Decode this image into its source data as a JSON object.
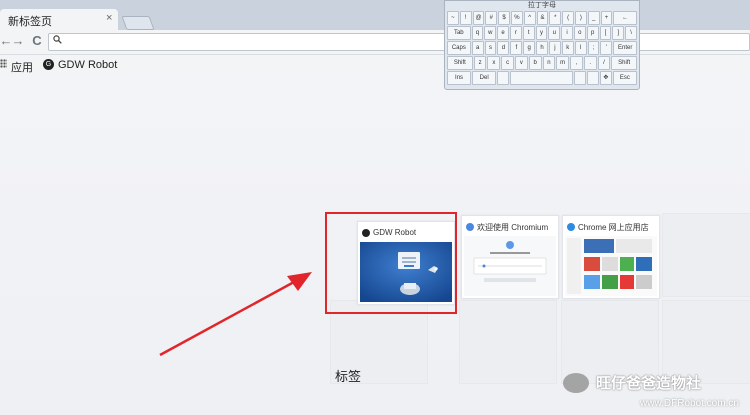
{
  "tab": {
    "title": "新标签页",
    "close": "×"
  },
  "toolbar": {
    "back": "←",
    "forward": "→",
    "reload": "C",
    "search_icon": "search-icon",
    "url": ""
  },
  "bookmarks": {
    "apps_label": "应用",
    "items": [
      {
        "label": "GDW Robot"
      }
    ]
  },
  "keyboard": {
    "title": "拉丁字母",
    "rows": [
      [
        "~",
        "!",
        "@",
        "#",
        "$",
        "%",
        "^",
        "&",
        "*",
        "(",
        ")",
        "_",
        "+",
        "←"
      ],
      [
        "Tab",
        "q",
        "w",
        "e",
        "r",
        "t",
        "y",
        "u",
        "i",
        "o",
        "p",
        "[",
        "]",
        "\\"
      ],
      [
        "Caps",
        "a",
        "s",
        "d",
        "f",
        "g",
        "h",
        "j",
        "k",
        "l",
        ";",
        "'",
        "Enter"
      ],
      [
        "Shift",
        "z",
        "x",
        "c",
        "v",
        "b",
        "n",
        "m",
        ",",
        ".",
        "/",
        "Shift"
      ],
      [
        "Ins",
        "Del",
        "",
        "",
        "",
        "",
        "✥",
        "Esc"
      ]
    ]
  },
  "thumbnails": [
    {
      "title": "GDW Robot"
    },
    {
      "title": "欢迎使用 Chromium"
    },
    {
      "title": "Chrome 网上应用店"
    }
  ],
  "annotation_label": "标签",
  "watermark": {
    "line1": "旺仔爸爸造物社",
    "line2": "www.DFRobot.com.cn"
  },
  "colors": {
    "highlight": "#e0262b",
    "tabstrip": "#c9d2dd"
  }
}
